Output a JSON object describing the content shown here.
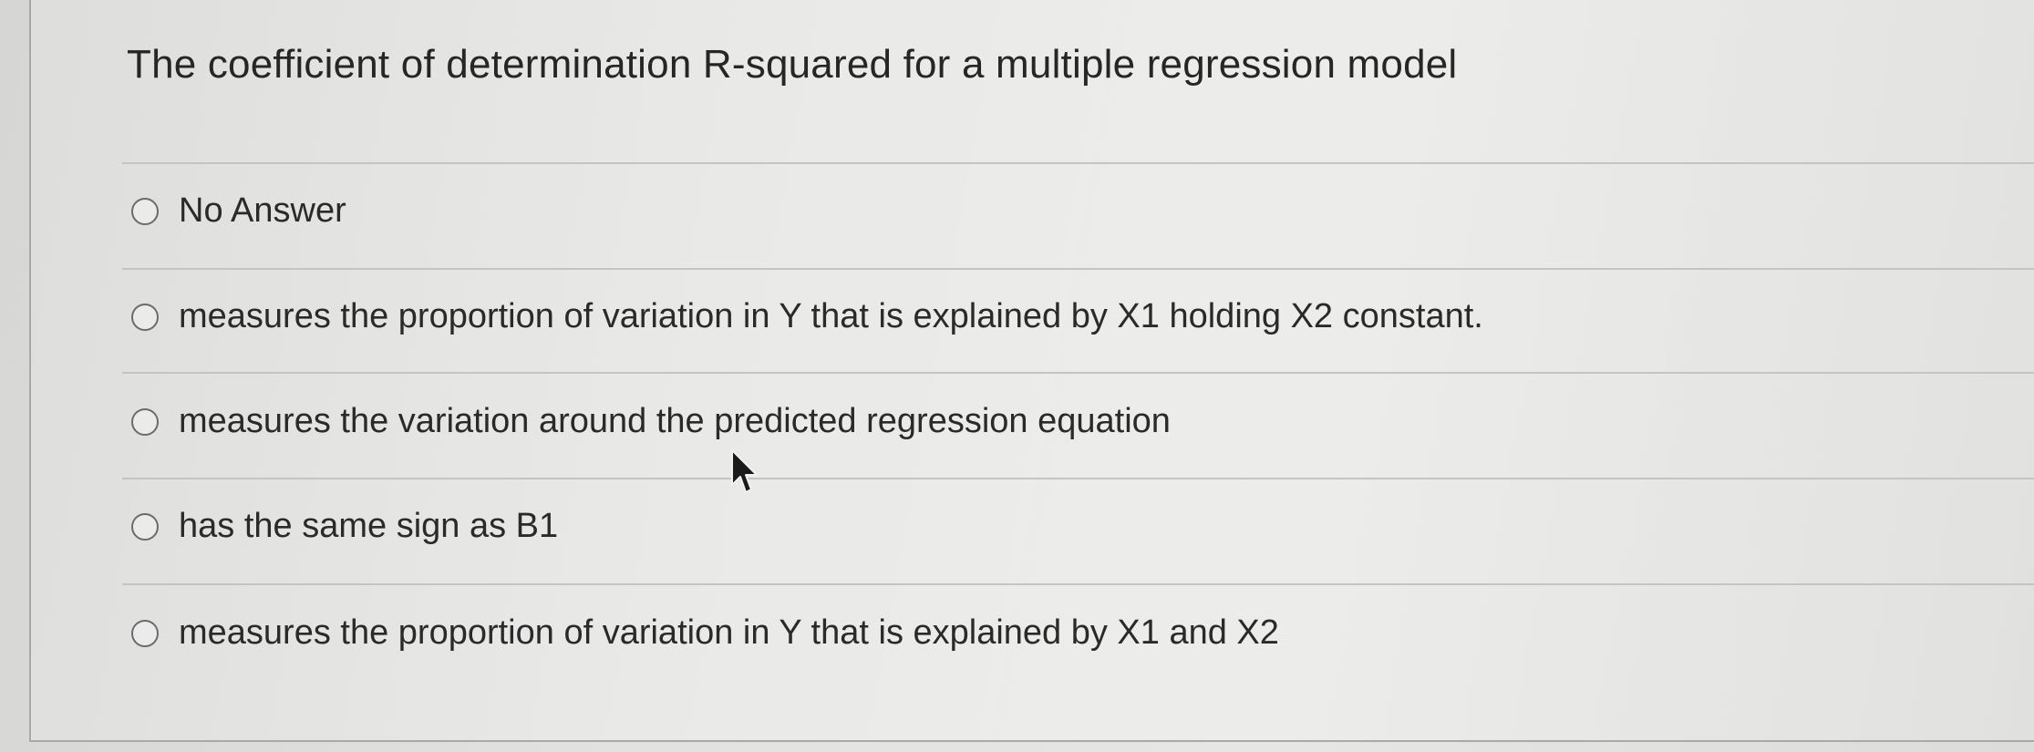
{
  "question": {
    "text": "The coefficient of determination R-squared for a multiple regression model"
  },
  "options": [
    {
      "label": "No Answer",
      "selected": false
    },
    {
      "label": "measures the proportion of variation in Y that is explained by X1 holding X2 constant.",
      "selected": false
    },
    {
      "label": "measures the variation around the predicted regression equation",
      "selected": false
    },
    {
      "label": "has the same sign as B1",
      "selected": false
    },
    {
      "label": "measures the proportion of variation in Y that is explained by X1 and X2",
      "selected": false
    }
  ],
  "cursor_icon": "mouse-pointer-icon"
}
